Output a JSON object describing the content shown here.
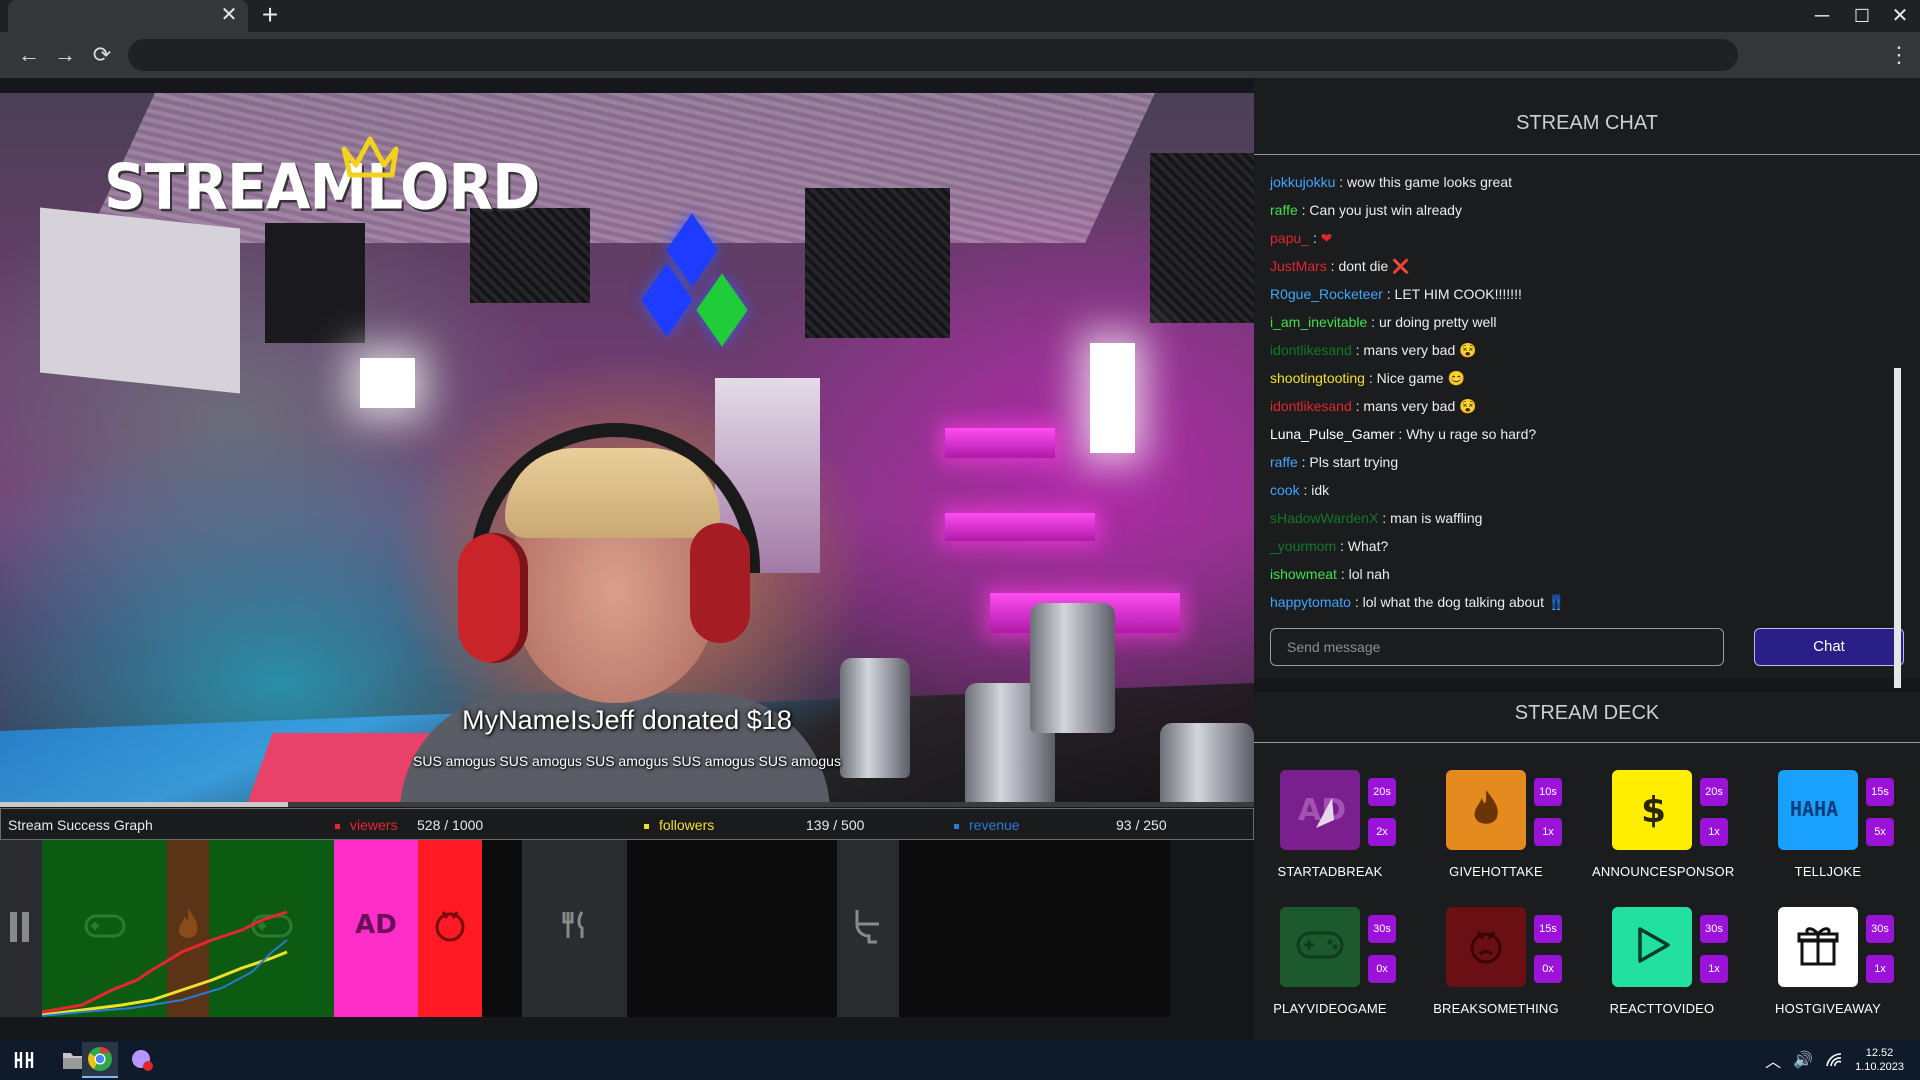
{
  "browser": {
    "tab_close": "✕",
    "new_tab": "+",
    "back": "←",
    "forward": "→",
    "reload": "⟳",
    "address_value": "",
    "menu": "⋮",
    "min": "─",
    "max": "☐",
    "close": "✕"
  },
  "stream": {
    "logo": "STREAMLORD",
    "donation_title": "MyNameIsJeff donated $18",
    "donation_message": "SUS amogus SUS amogus SUS amogus SUS amogus SUS amogus",
    "progress_fraction": 0.23
  },
  "stats": {
    "graph_title": "Stream Success Graph",
    "viewers_label": "viewers",
    "viewers_value": "528 / 1000",
    "followers_label": "followers",
    "followers_value": "139 / 500",
    "revenue_label": "revenue",
    "revenue_value": "93 / 250",
    "colors": {
      "viewers": "#e8262e",
      "followers": "#f0e02a",
      "revenue": "#2a7bd6"
    }
  },
  "timeline": {
    "segments": [
      "play-videogame",
      "give-hot-take",
      "play-videogame",
      "start-ad-break",
      "break-something",
      "idle",
      "eat",
      "idle",
      "toilet",
      "idle"
    ],
    "ad_label": "AD"
  },
  "chat": {
    "title": "STREAM CHAT",
    "messages": [
      {
        "user": "jokkujokku",
        "color": "#3fa7ff",
        "text": " : wow this game looks great",
        "emoji": ""
      },
      {
        "user": "raffe",
        "color": "#40e24a",
        "text": " : Can you just win already",
        "emoji": ""
      },
      {
        "user": "papu_",
        "color": "#e0262e",
        "text": " : ",
        "emoji": "❤"
      },
      {
        "user": "JustMars",
        "color": "#e0262e",
        "text": " : dont die ",
        "emoji": "❌"
      },
      {
        "user": "R0gue_Rocketeer",
        "color": "#3fa7ff",
        "text": " : LET HIM COOK!!!!!!!",
        "emoji": ""
      },
      {
        "user": "i_am_inevitable",
        "color": "#40e24a",
        "text": " : ur doing pretty well",
        "emoji": ""
      },
      {
        "user": "idontlikesand",
        "color": "#0f7a28",
        "text": " : mans very bad ",
        "emoji": "😵"
      },
      {
        "user": "shootingtooting",
        "color": "#f0e02a",
        "text": " : Nice game ",
        "emoji": "😊"
      },
      {
        "user": "idontlikesand",
        "color": "#e0262e",
        "text": " : mans very bad ",
        "emoji": "😵"
      },
      {
        "user": "Luna_Pulse_Gamer",
        "color": "#ffffff",
        "text": " : Why u rage so hard?",
        "emoji": ""
      },
      {
        "user": "raffe",
        "color": "#3fa7ff",
        "text": " : Pls start trying",
        "emoji": ""
      },
      {
        "user": "cook",
        "color": "#3fa7ff",
        "text": " : idk",
        "emoji": ""
      },
      {
        "user": "sHadowWardenX",
        "color": "#0f7a28",
        "text": " : man is waffling",
        "emoji": ""
      },
      {
        "user": "_yourmom",
        "color": "#0f7a28",
        "text": " : What?",
        "emoji": ""
      },
      {
        "user": "ishowmeat",
        "color": "#40e24a",
        "text": " : lol nah",
        "emoji": ""
      },
      {
        "user": "happytomato",
        "color": "#3fa7ff",
        "text": " : lol what the dog talking about ",
        "emoji": "👖"
      }
    ],
    "input_placeholder": "Send message",
    "button": "Chat"
  },
  "deck": {
    "title": "STREAM DECK",
    "items": [
      {
        "label": "STARTADBREAK",
        "duration": "20s",
        "count": "2x",
        "icon": "ad-icon",
        "color": "#7b1f8f"
      },
      {
        "label": "GIVEHOTTAKE",
        "duration": "10s",
        "count": "1x",
        "icon": "flame-icon",
        "color": "#e58a1e"
      },
      {
        "label": "ANNOUNCESPONSOR",
        "duration": "20s",
        "count": "1x",
        "icon": "dollar-icon",
        "color": "#ffee00"
      },
      {
        "label": "TELLJOKE",
        "duration": "15s",
        "count": "5x",
        "icon": "haha-icon",
        "color": "#1aa0ff"
      },
      {
        "label": "PLAYVIDEOGAME",
        "duration": "30s",
        "count": "0x",
        "icon": "gamepad-icon",
        "color": "#1c5a2e"
      },
      {
        "label": "BREAKSOMETHING",
        "duration": "15s",
        "count": "0x",
        "icon": "rage-icon",
        "color": "#6a1015"
      },
      {
        "label": "REACTTOVIDEO",
        "duration": "30s",
        "count": "1x",
        "icon": "play-icon",
        "color": "#22e0a0"
      },
      {
        "label": "HOSTGIVEAWAY",
        "duration": "30s",
        "count": "1x",
        "icon": "gift-icon",
        "color": "#ffffff"
      }
    ]
  },
  "taskbar": {
    "clock_time": "12.52",
    "clock_date": "1.10.2023"
  }
}
